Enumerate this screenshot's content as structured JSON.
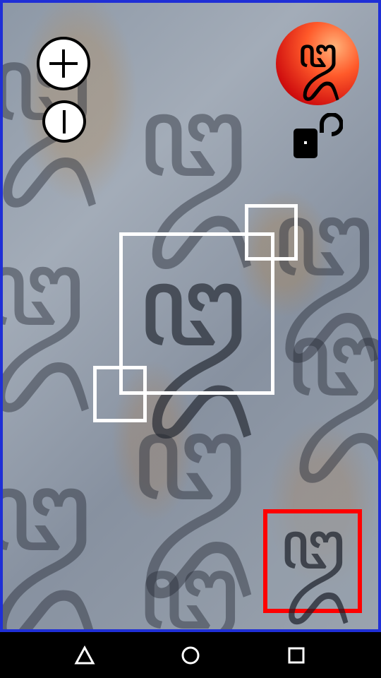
{
  "letter": {
    "glyph": "ꦈ"
  },
  "controls": {
    "zoom_icon": "plus-icon",
    "info_icon": "info-icon",
    "lock_icon": "unlocked-padlock-icon"
  },
  "colors": {
    "border": "#1f2fd6",
    "selection": "#ffffff",
    "reference_box": "#ff0000",
    "ball": "#d00f0f"
  },
  "navbar": {
    "icons": [
      "back-triangle-icon",
      "home-circle-icon",
      "recent-square-icon"
    ]
  }
}
